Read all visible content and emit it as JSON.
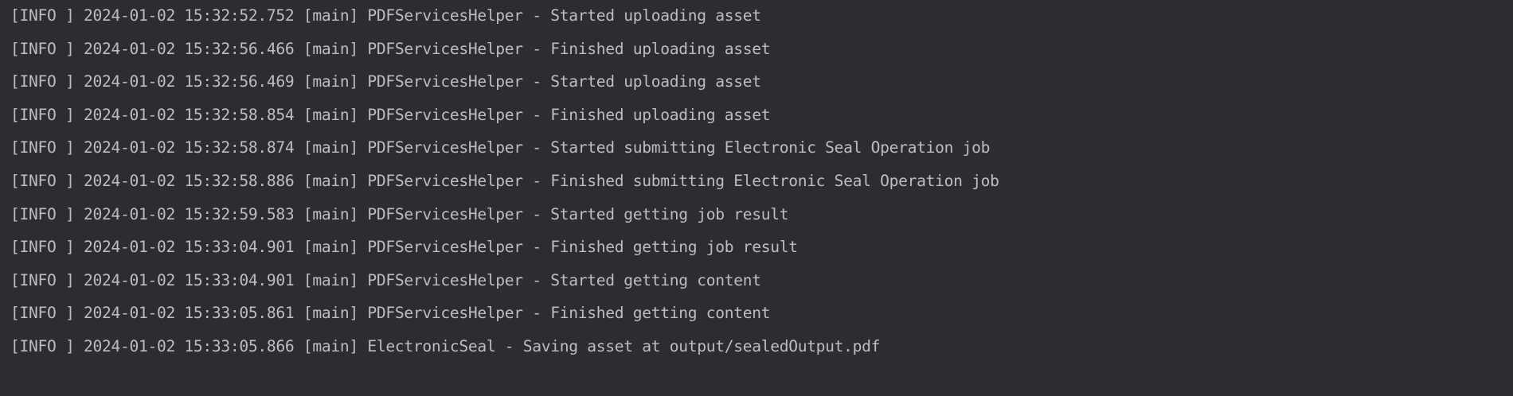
{
  "console": {
    "lines": [
      "[INFO ] 2024-01-02 15:32:52.752 [main] PDFServicesHelper - Started uploading asset",
      "[INFO ] 2024-01-02 15:32:56.466 [main] PDFServicesHelper - Finished uploading asset",
      "[INFO ] 2024-01-02 15:32:56.469 [main] PDFServicesHelper - Started uploading asset",
      "[INFO ] 2024-01-02 15:32:58.854 [main] PDFServicesHelper - Finished uploading asset",
      "[INFO ] 2024-01-02 15:32:58.874 [main] PDFServicesHelper - Started submitting Electronic Seal Operation job",
      "[INFO ] 2024-01-02 15:32:58.886 [main] PDFServicesHelper - Finished submitting Electronic Seal Operation job",
      "[INFO ] 2024-01-02 15:32:59.583 [main] PDFServicesHelper - Started getting job result",
      "[INFO ] 2024-01-02 15:33:04.901 [main] PDFServicesHelper - Finished getting job result",
      "[INFO ] 2024-01-02 15:33:04.901 [main] PDFServicesHelper - Started getting content",
      "[INFO ] 2024-01-02 15:33:05.861 [main] PDFServicesHelper - Finished getting content",
      "[INFO ] 2024-01-02 15:33:05.866 [main] ElectronicSeal - Saving asset at output/sealedOutput.pdf"
    ]
  }
}
